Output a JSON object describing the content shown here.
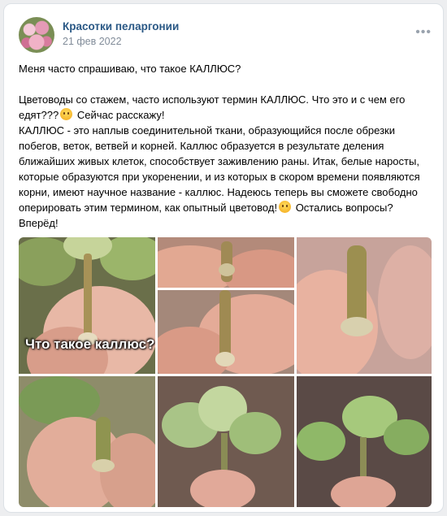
{
  "post": {
    "author": "Красотки пеларгонии",
    "date": "21 фев 2022",
    "text_lines": [
      "Меня часто спрашиваю, что такое КАЛЛЮС?",
      "Цветоводы со стажем, часто используют термин КАЛЛЮС. Что это и с чем его едят???",
      "Сейчас расскажу!",
      "КАЛЛЮС - это наплыв соединительной ткани, образующийся после обрезки побегов, веток, ветвей и корней. Каллюс образуется в результате деления ближайших живых клеток, способствует заживлению раны. Итак, белые наросты, которые образуются при укоренении, и из которых в скором времени появляются корни, имеют научное название - каллюс. Надеюсь теперь вы сможете свободно оперировать этим термином, как опытный цветовод!",
      "Остались вопросы? Вперёд!"
    ]
  },
  "gallery": {
    "overlay_text": "Что такое каллюс?",
    "photos": [
      {
        "name": "photo-1",
        "subject": "callus-cutting-leaves"
      },
      {
        "name": "photo-2",
        "subject": "callus-closeup"
      },
      {
        "name": "photo-3",
        "subject": "callus-cutting-fingers"
      },
      {
        "name": "photo-4",
        "subject": "callus-stem"
      },
      {
        "name": "photo-5",
        "subject": "callus-base"
      },
      {
        "name": "photo-6",
        "subject": "small-callus-cutting"
      },
      {
        "name": "photo-7",
        "subject": "rooted-cutting-leaves"
      },
      {
        "name": "photo-8",
        "subject": "rooted-cutting-leaves-2"
      }
    ]
  },
  "icons": {
    "more": "more-dots-icon",
    "emoji_1": "grinning-emoji-icon",
    "emoji_2": "winking-emoji-icon"
  },
  "colors": {
    "link": "#2a5885",
    "meta": "#818c99",
    "background": "#edeef0"
  }
}
